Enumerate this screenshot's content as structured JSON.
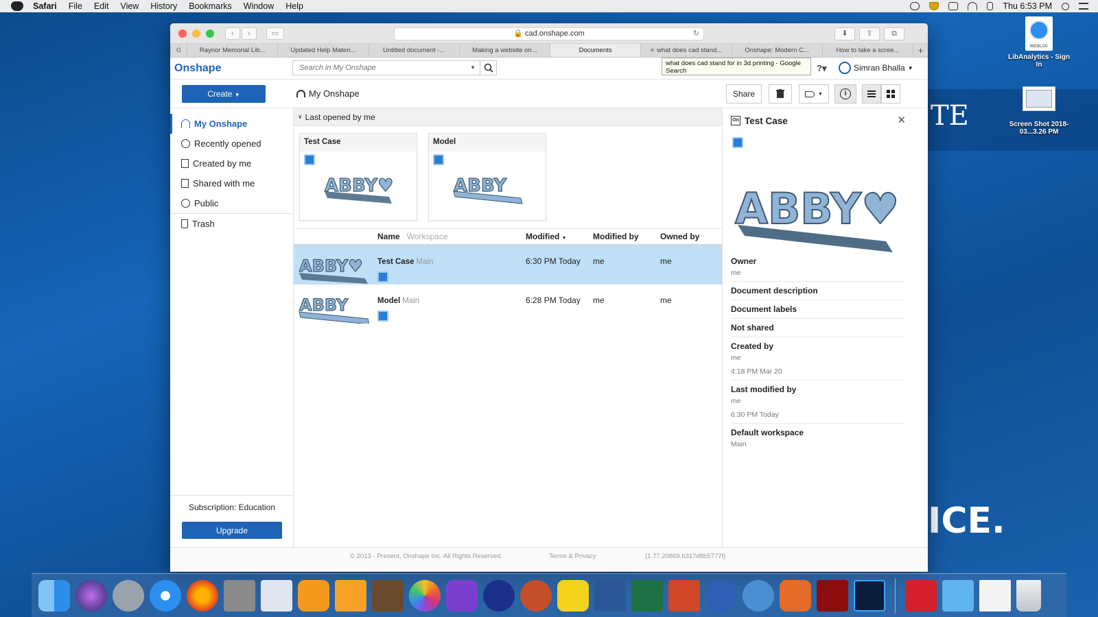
{
  "menubar": {
    "app": "Safari",
    "items": [
      "File",
      "Edit",
      "View",
      "History",
      "Bookmarks",
      "Window",
      "Help"
    ],
    "clock": "Thu 6:53 PM"
  },
  "desktop": {
    "big_text_1": "TE",
    "big_text_2": "ICE.",
    "icons": [
      {
        "label": "LibAnalytics - Sign In",
        "tag": "WEBLOC"
      },
      {
        "label": "Screen Shot 2018-03...3.26 PM"
      }
    ]
  },
  "browser": {
    "url": "cad.onshape.com",
    "tabs": [
      "Raynor Memorial Lib...",
      "Updated Help Materi...",
      "Untitled document -...",
      "Making a website on...",
      "Documents",
      "what does cad stand...",
      "Onshape: Modern C...",
      "How to take a scree..."
    ],
    "active_tab": 4,
    "tooltip": "what does cad stand for in 3d printing - Google Search"
  },
  "onshape": {
    "logo": "Onshape",
    "search_placeholder": "Search in My Onshape",
    "user": "Simran Bhalla",
    "create_label": "Create",
    "breadcrumb": "My Onshape",
    "share_label": "Share",
    "nav": [
      {
        "label": "My Onshape",
        "icon": "my-onshape-icon"
      },
      {
        "label": "Recently opened",
        "icon": "clock-icon"
      },
      {
        "label": "Created by me",
        "icon": "document-icon"
      },
      {
        "label": "Shared with me",
        "icon": "shared-icon"
      },
      {
        "label": "Public",
        "icon": "globe-icon"
      },
      {
        "label": "Trash",
        "icon": "trash-icon"
      }
    ],
    "subscription": "Subscription: Education",
    "upgrade_label": "Upgrade",
    "section_title": "Last opened by me",
    "cards": [
      {
        "title": "Test Case",
        "thumb_text": "ABBY♥"
      },
      {
        "title": "Model",
        "thumb_text": "ABBY"
      }
    ],
    "table": {
      "headers": {
        "name": "Name",
        "workspace": "Workspace",
        "modified": "Modified",
        "modified_by": "Modified by",
        "owned_by": "Owned by"
      },
      "rows": [
        {
          "name": "Test Case",
          "workspace": "Main",
          "modified": "6:30 PM Today",
          "modified_by": "me",
          "owned_by": "me",
          "thumb_text": "ABBY♥"
        },
        {
          "name": "Model",
          "workspace": "Main",
          "modified": "6:28 PM Today",
          "modified_by": "me",
          "owned_by": "me",
          "thumb_text": "ABBY"
        }
      ]
    },
    "details": {
      "title": "Test Case",
      "preview_text": "ABBY♥",
      "owner_label": "Owner",
      "owner": "me",
      "description_label": "Document description",
      "labels_label": "Document labels",
      "shared_label": "Not shared",
      "created_by_label": "Created by",
      "created_by": "me",
      "created_at": "4:18 PM Mar 20",
      "last_modified_label": "Last modified by",
      "last_modified_by": "me",
      "last_modified_at": "6:30 PM Today",
      "workspace_label": "Default workspace",
      "workspace": "Main"
    },
    "footer": {
      "copyright": "© 2013 - Present, Onshape Inc. All Rights Reserved.",
      "terms": "Terms & Privacy",
      "version": "(1.77.20869.b317d8b5777f)"
    }
  },
  "colors": {
    "accent": "#1e63b6",
    "selected_row": "#bfe0f7",
    "model": "#8fb4d6"
  }
}
